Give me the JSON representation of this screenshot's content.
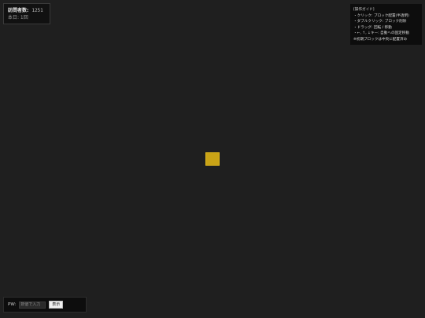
{
  "visitor": {
    "label": "訪問者数:",
    "count": "1251",
    "today": "本日: 1回"
  },
  "guide": {
    "lines": [
      "[操作ガイド]",
      "・クリック: ブロック配置(半透明)",
      "・ダブルクリック: ブロック削除",
      "・ドラッグ: 回転 / 移動",
      "・←, ↑, ↓キー: 自動への固定移動",
      "※初期ブロックは中央に配置済み"
    ]
  },
  "block": {
    "color": "#c9a316"
  },
  "password": {
    "label": "PW:",
    "placeholder": "数値で入力",
    "button_label": "表示"
  }
}
